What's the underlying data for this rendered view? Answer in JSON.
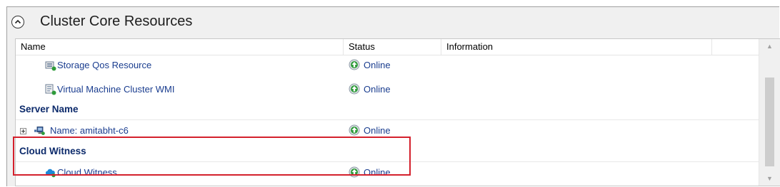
{
  "section": {
    "title": "Cluster Core Resources"
  },
  "columns": {
    "name": "Name",
    "status": "Status",
    "information": "Information"
  },
  "rows": [
    {
      "name": "Storage Qos Resource",
      "status": "Online",
      "icon": "storage-qos-icon"
    },
    {
      "name": "Virtual Machine Cluster WMI",
      "status": "Online",
      "icon": "vm-cluster-wmi-icon"
    }
  ],
  "groups": {
    "server_name": {
      "label": "Server Name",
      "rows": [
        {
          "name": "Name: amitabht-c6",
          "status": "Online",
          "icon": "network-name-icon"
        }
      ]
    },
    "cloud_witness": {
      "label": "Cloud Witness",
      "rows": [
        {
          "name": "Cloud Witness",
          "status": "Online",
          "icon": "cloud-witness-icon"
        }
      ]
    }
  },
  "colors": {
    "highlight": "#d4202c",
    "link_text": "#1a3d8f",
    "group_text": "#0c2a6b",
    "online_green": "#2e9b3a"
  }
}
